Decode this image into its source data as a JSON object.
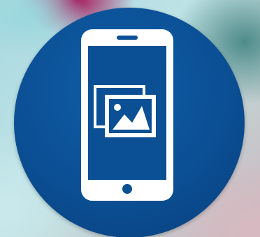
{
  "icons": {
    "app_icon": "gallery-app-icon",
    "phone": "smartphone-icon",
    "photos": "photo-gallery-icon"
  },
  "colors": {
    "icon_background": "#0b4f94",
    "glyph": "#ffffff"
  }
}
